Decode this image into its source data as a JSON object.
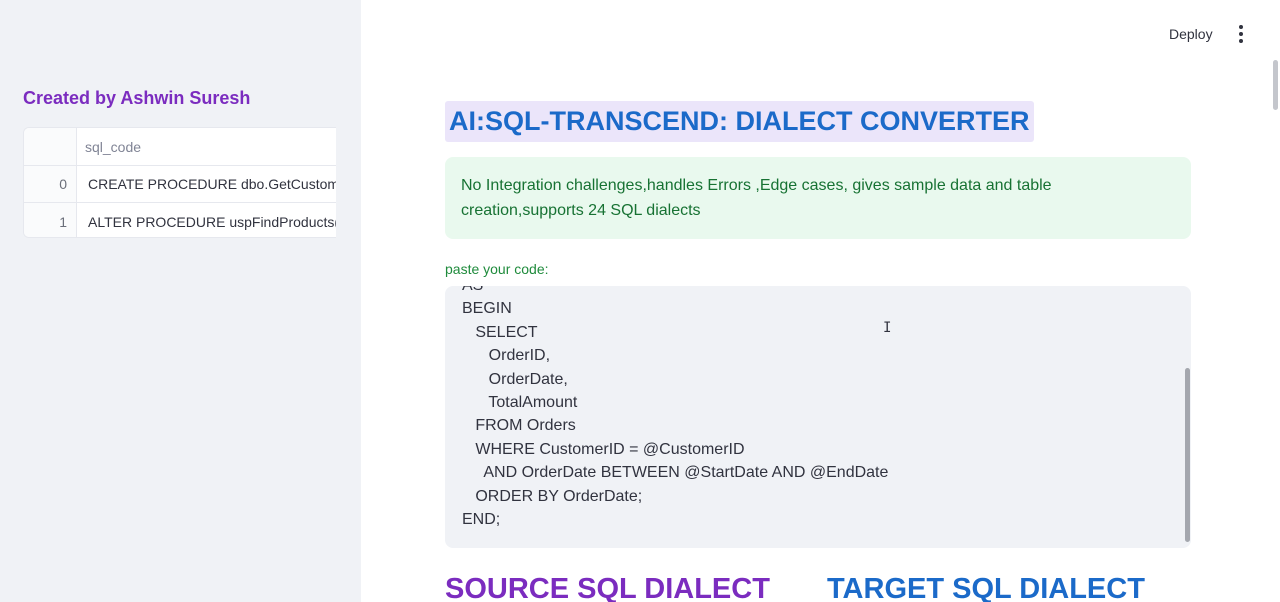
{
  "sidebar": {
    "title": "Created by Ashwin Suresh",
    "dataframe": {
      "columns": [
        "",
        "sql_code"
      ],
      "rows": [
        {
          "index": "0",
          "value": "CREATE PROCEDURE dbo.GetCustomerSa"
        },
        {
          "index": "1",
          "value": "ALTER PROCEDURE uspFindProducts(@m"
        }
      ]
    }
  },
  "header": {
    "deploy_label": "Deploy",
    "menu_icon": "vertical-ellipsis-icon"
  },
  "main": {
    "title": "AI:SQL-TRANSCEND: DIALECT CONVERTER",
    "success_message": "No Integration challenges,handles Errors ,Edge cases, gives sample data and table creation,supports 24 SQL dialects",
    "code_label": "paste your code:",
    "code_value": "AS\nBEGIN\n   SELECT\n      OrderID,\n      OrderDate,\n      TotalAmount\n   FROM Orders\n   WHERE CustomerID = @CustomerID\n     AND OrderDate BETWEEN @StartDate AND @EndDate\n   ORDER BY OrderDate;\nEND;",
    "source_heading": "SOURCE SQL DIALECT",
    "target_heading": "TARGET SQL DIALECT"
  },
  "colors": {
    "accent_purple": "#7b2cbf",
    "accent_blue": "#1b6ac9",
    "success_text": "#177233",
    "success_bg": "#e9f9ee",
    "title_bg": "#ebe5fa"
  }
}
